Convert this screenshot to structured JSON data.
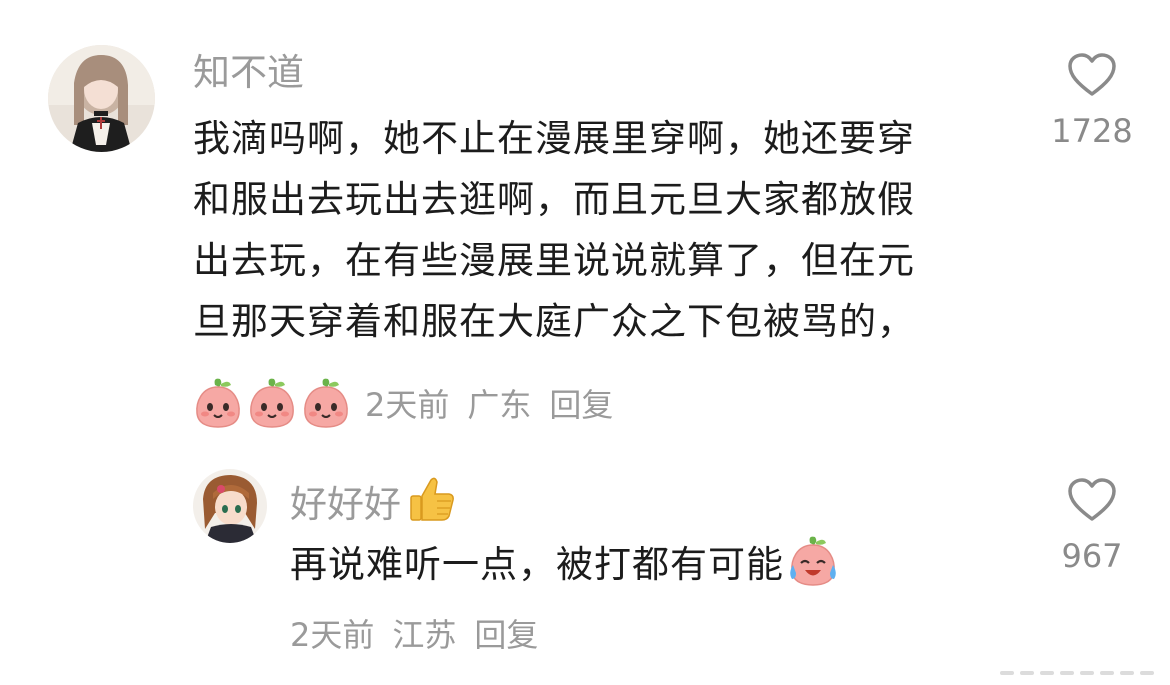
{
  "comments": [
    {
      "username": "知不道",
      "content_lines": [
        "我滴吗啊，她不止在漫展里穿啊，她还要穿",
        "和服出去玩出去逛啊，而且元旦大家都放假",
        "出去玩，在有些漫展里说说就算了，但在元",
        "旦那天穿着和服在大庭广众之下包被骂的，"
      ],
      "emojis": [
        "peach-face-icon",
        "peach-face-icon",
        "peach-face-icon"
      ],
      "time": "2天前",
      "location": "广东",
      "reply_label": "回复",
      "like_count": "1728",
      "like_icon": "heart-outline-icon"
    },
    {
      "username": "好好好",
      "username_emoji": "thumbs-up-icon",
      "content": "再说难听一点，被打都有可能",
      "content_emoji": "peach-crying-laughing-icon",
      "time": "2天前",
      "location": "江苏",
      "reply_label": "回复",
      "like_count": "967",
      "like_icon": "heart-outline-icon"
    }
  ],
  "colors": {
    "text": "#1c1c1c",
    "secondary": "#9a9a9a",
    "background": "#ffffff",
    "peach": "#f6a8a4",
    "leaf": "#6bb34a"
  }
}
